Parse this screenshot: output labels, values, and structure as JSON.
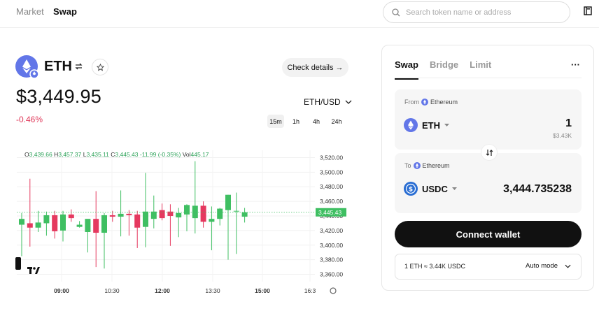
{
  "nav": {
    "market": "Market",
    "swap": "Swap"
  },
  "search": {
    "placeholder": "Search token name or address"
  },
  "token": {
    "symbol": "ETH",
    "price": "$3,449.95",
    "change": "-0.46%",
    "details_button": "Check details →",
    "pair": "ETH/USD"
  },
  "intervals": [
    "15m",
    "1h",
    "4h",
    "24h"
  ],
  "ohlc": {
    "o_label": "O",
    "o": "3,439.66",
    "h_label": "H",
    "h": "3,457.37",
    "l_label": "L",
    "l": "3,435.11",
    "c_label": "C",
    "c": "3,445.43",
    "change": "-11.99 (-0.35%)",
    "vol_label": "Vol",
    "vol": "445.17"
  },
  "chart_data": {
    "type": "candlestick",
    "y_ticks": [
      "3,520.00",
      "3,500.00",
      "3,480.00",
      "3,460.00",
      "3,440.00",
      "3,420.00",
      "3,400.00",
      "3,380.00",
      "3,360.00"
    ],
    "ylim": [
      3350,
      3530
    ],
    "last_price_label": "3,445.43",
    "x_ticks": [
      "09:00",
      "10:30",
      "12:00",
      "13:30",
      "15:00",
      "16:3"
    ],
    "candles": [
      {
        "o": 3428,
        "h": 3444,
        "l": 3385,
        "c": 3436
      },
      {
        "o": 3430,
        "h": 3491,
        "l": 3398,
        "c": 3424
      },
      {
        "o": 3424,
        "h": 3447,
        "l": 3418,
        "c": 3431
      },
      {
        "o": 3430,
        "h": 3446,
        "l": 3413,
        "c": 3441
      },
      {
        "o": 3441,
        "h": 3447,
        "l": 3409,
        "c": 3419
      },
      {
        "o": 3420,
        "h": 3447,
        "l": 3405,
        "c": 3442
      },
      {
        "o": 3442,
        "h": 3449,
        "l": 3432,
        "c": 3437
      },
      {
        "o": 3425,
        "h": 3433,
        "l": 3424,
        "c": 3428
      },
      {
        "o": 3418,
        "h": 3427,
        "l": 3390,
        "c": 3436
      },
      {
        "o": 3436,
        "h": 3474,
        "l": 3370,
        "c": 3417
      },
      {
        "o": 3417,
        "h": 3444,
        "l": 3368,
        "c": 3441
      },
      {
        "o": 3441,
        "h": 3447,
        "l": 3432,
        "c": 3439
      },
      {
        "o": 3439,
        "h": 3475,
        "l": 3412,
        "c": 3443
      },
      {
        "o": 3443,
        "h": 3448,
        "l": 3413,
        "c": 3441
      },
      {
        "o": 3442,
        "h": 3447,
        "l": 3396,
        "c": 3424
      },
      {
        "o": 3425,
        "h": 3499,
        "l": 3397,
        "c": 3446
      },
      {
        "o": 3436,
        "h": 3468,
        "l": 3423,
        "c": 3446
      },
      {
        "o": 3448,
        "h": 3457,
        "l": 3434,
        "c": 3437
      },
      {
        "o": 3446,
        "h": 3456,
        "l": 3399,
        "c": 3440
      },
      {
        "o": 3438,
        "h": 3451,
        "l": 3411,
        "c": 3444
      },
      {
        "o": 3442,
        "h": 3456,
        "l": 3419,
        "c": 3455
      },
      {
        "o": 3437,
        "h": 3515,
        "l": 3416,
        "c": 3454
      },
      {
        "o": 3454,
        "h": 3460,
        "l": 3424,
        "c": 3432
      },
      {
        "o": 3432,
        "h": 3453,
        "l": 3393,
        "c": 3436
      },
      {
        "o": 3436,
        "h": 3451,
        "l": 3427,
        "c": 3450
      },
      {
        "o": 3448,
        "h": 3469,
        "l": 3380,
        "c": 3469
      },
      {
        "o": 3447,
        "h": 3472,
        "l": 3388,
        "c": 3447
      },
      {
        "o": 3439,
        "h": 3451,
        "l": 3431,
        "c": 3445
      }
    ]
  },
  "swap": {
    "tabs": [
      "Swap",
      "Bridge",
      "Limit"
    ],
    "more": "···",
    "from_label": "From",
    "from_network": "Ethereum",
    "from_token": "ETH",
    "from_amount": "1",
    "from_usd": "$3.43K",
    "to_label": "To",
    "to_network": "Ethereum",
    "to_token": "USDC",
    "to_amount": "3,444.735238",
    "connect": "Connect wallet",
    "rate": "1 ETH ≈ 3.44K USDC",
    "mode": "Auto mode"
  },
  "colors": {
    "up": "#3fbf62",
    "down": "#e5395f",
    "accent": "#6276e8",
    "usdc": "#2a6ed3"
  }
}
